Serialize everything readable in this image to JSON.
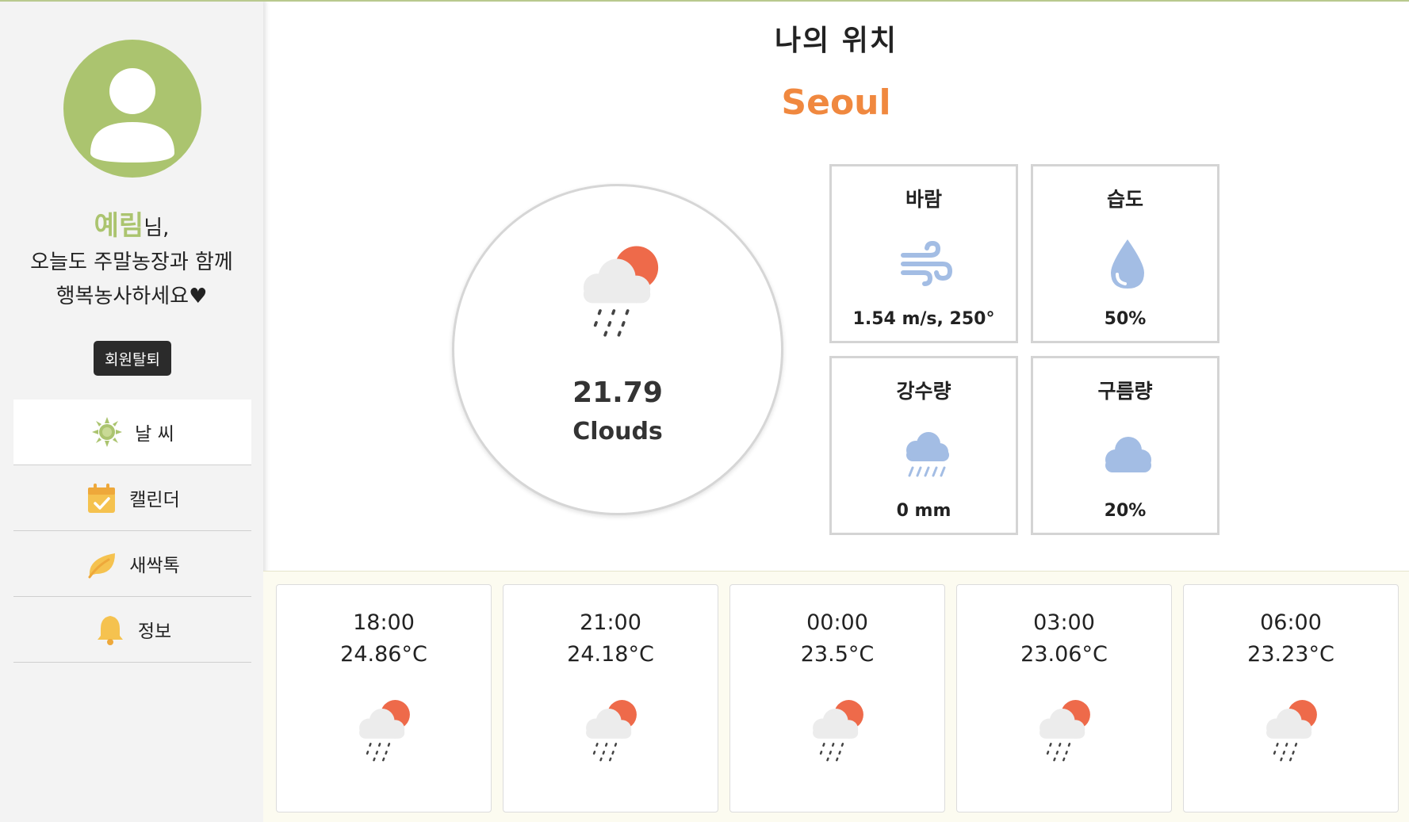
{
  "sidebar": {
    "user_name": "예림",
    "name_suffix": "님,",
    "message_line1": "오늘도 주말농장과 함께",
    "message_line2": "행복농사하세요♥",
    "withdraw_label": "회원탈퇴",
    "nav": [
      {
        "label": "날 씨",
        "icon": "sun-icon",
        "active": true
      },
      {
        "label": "캘린더",
        "icon": "calendar-icon",
        "active": false
      },
      {
        "label": "새싹톡",
        "icon": "leaf-icon",
        "active": false
      },
      {
        "label": "정보",
        "icon": "bell-icon",
        "active": false
      }
    ]
  },
  "main": {
    "title": "나의 위치",
    "city": "Seoul",
    "current": {
      "temperature": "21.79",
      "description": "Clouds",
      "icon": "cloud-sun-rain-icon"
    },
    "stats": [
      {
        "label": "바람",
        "value": "1.54 m/s, 250°",
        "icon": "wind-icon"
      },
      {
        "label": "습도",
        "value": "50%",
        "icon": "droplet-icon"
      },
      {
        "label": "강수량",
        "value": "0 mm",
        "icon": "rain-cloud-icon"
      },
      {
        "label": "구름량",
        "value": "20%",
        "icon": "cloud-icon"
      }
    ],
    "forecast": [
      {
        "time": "18:00",
        "temp": "24.86°C",
        "icon": "cloud-sun-rain-icon"
      },
      {
        "time": "21:00",
        "temp": "24.18°C",
        "icon": "cloud-sun-rain-icon"
      },
      {
        "time": "00:00",
        "temp": "23.5°C",
        "icon": "cloud-sun-rain-icon"
      },
      {
        "time": "03:00",
        "temp": "23.06°C",
        "icon": "cloud-sun-rain-icon"
      },
      {
        "time": "06:00",
        "temp": "23.23°C",
        "icon": "cloud-sun-rain-icon"
      }
    ]
  },
  "colors": {
    "accent_green": "#abc46f",
    "city_orange": "#f0883f",
    "stat_icon_blue": "#a3bde4",
    "sun_red": "#ee6a4a"
  }
}
